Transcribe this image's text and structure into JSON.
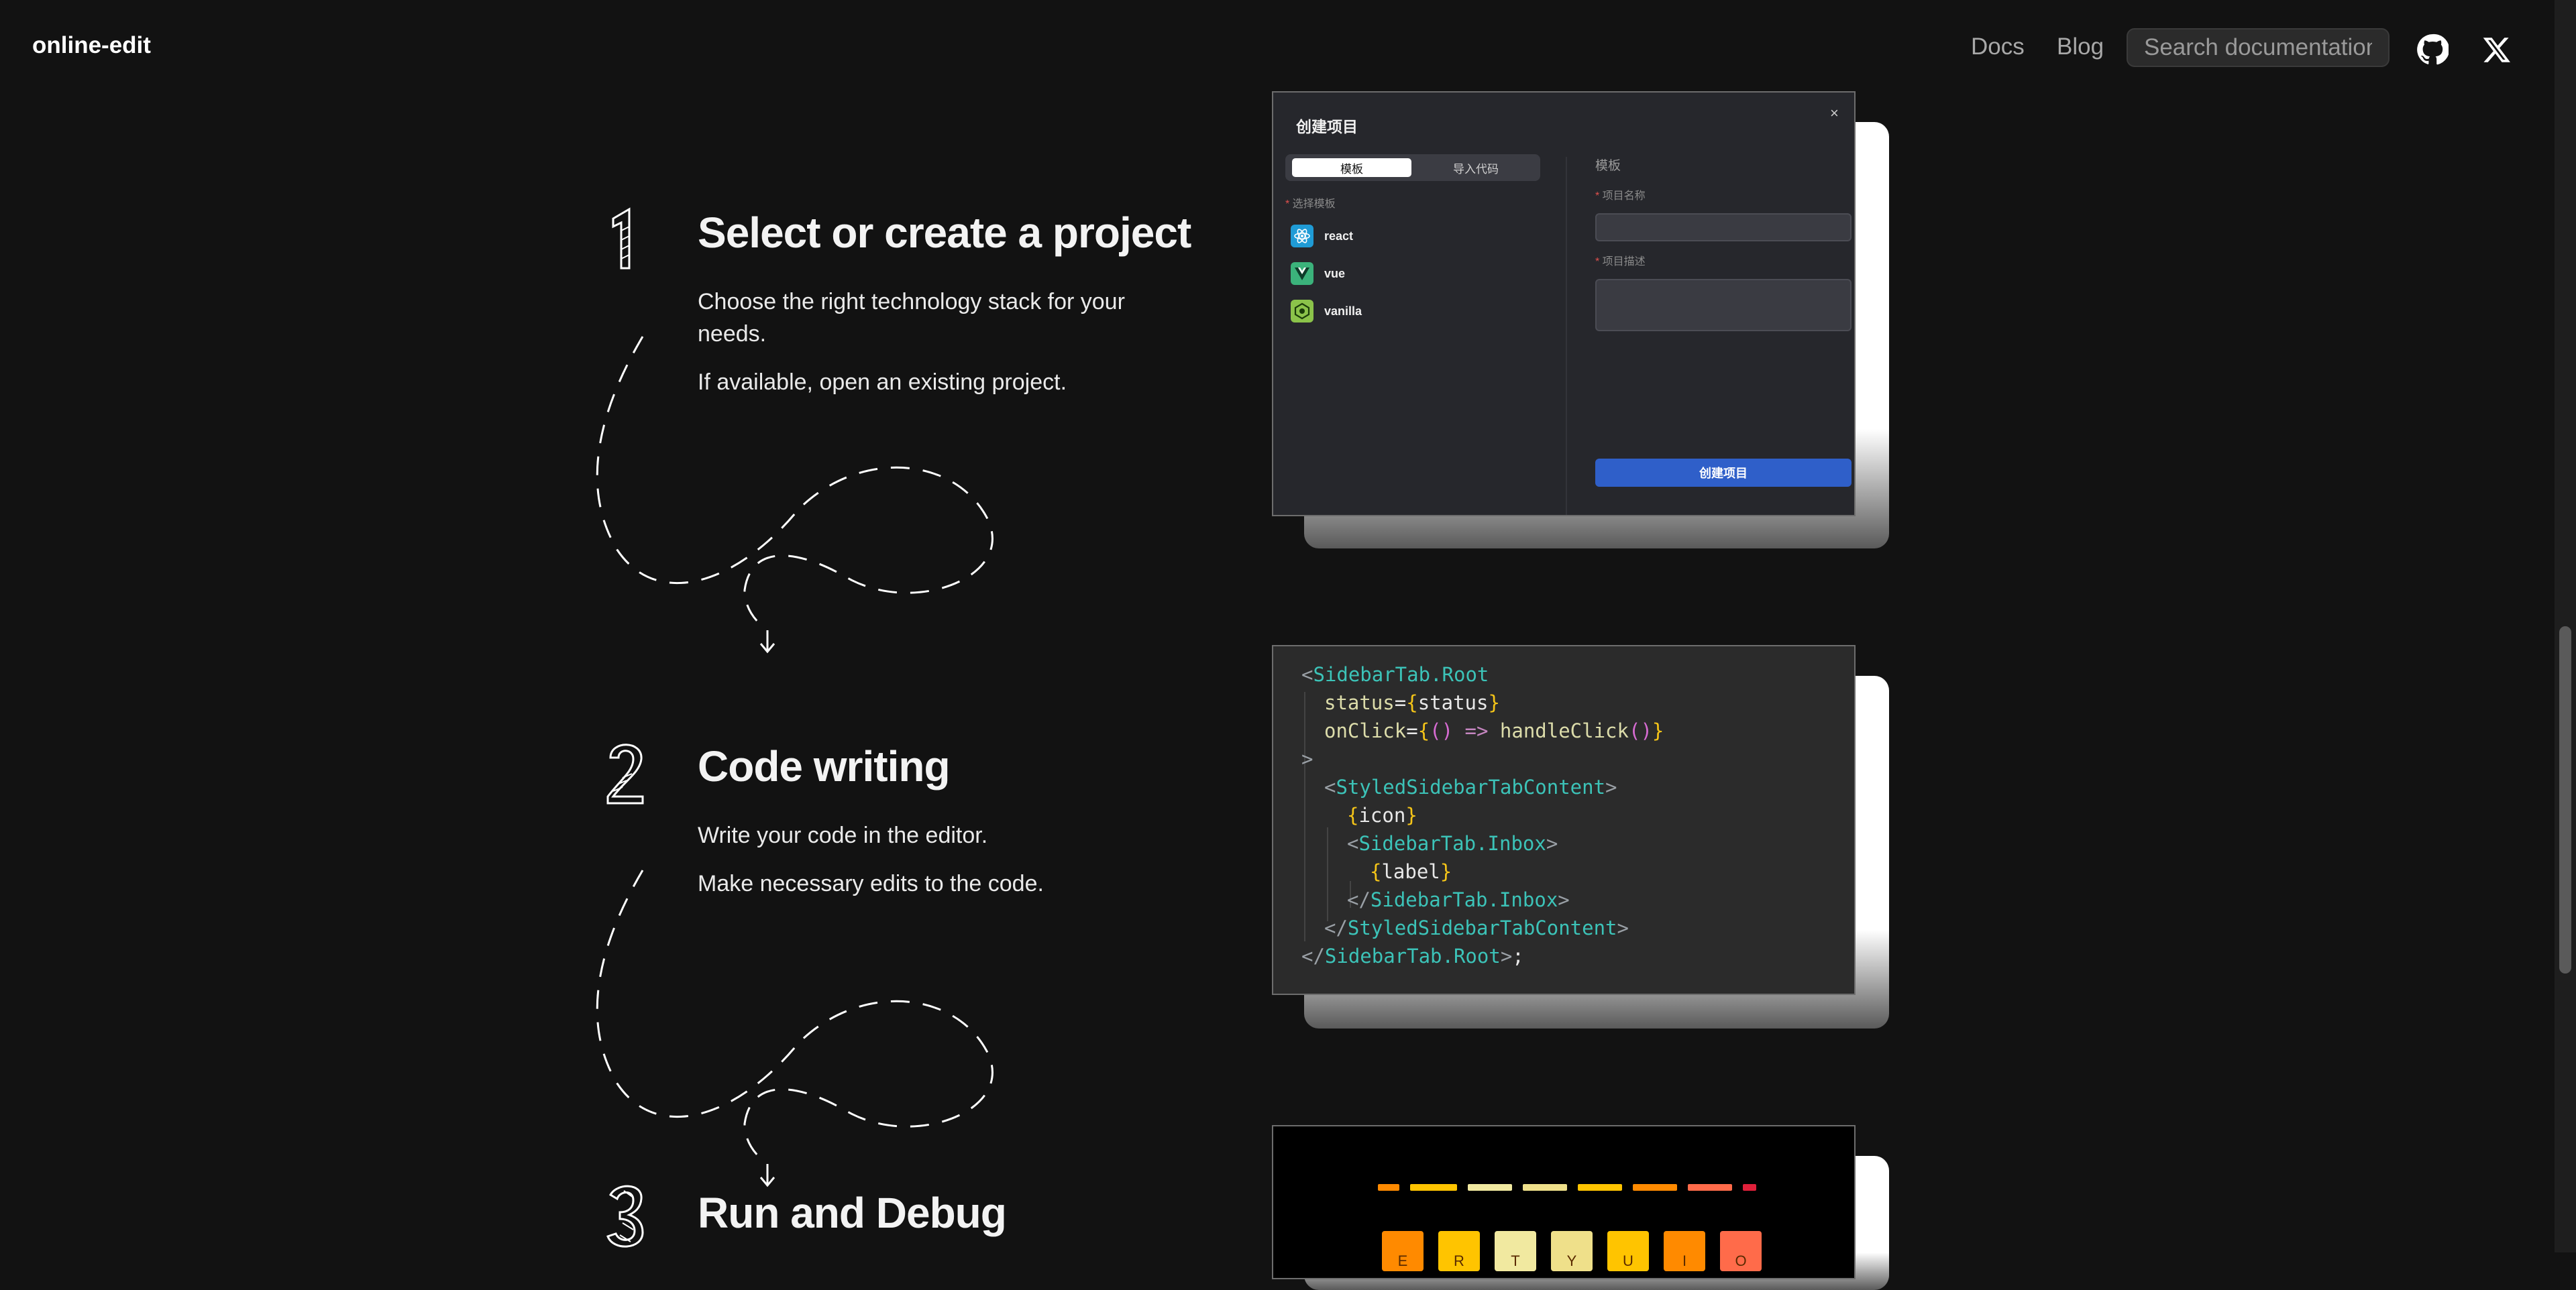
{
  "nav": {
    "brand": "online-edit",
    "links": [
      "Docs",
      "Blog"
    ],
    "search_placeholder": "Search documentation",
    "icons": [
      "github-icon",
      "x-icon"
    ]
  },
  "steps": [
    {
      "number": "1",
      "title": "Select or create a project",
      "paragraphs": [
        "Choose the right technology stack for your needs.",
        "If available, open an existing project."
      ]
    },
    {
      "number": "2",
      "title": "Code writing",
      "paragraphs": [
        "Write your code in the editor.",
        "Make necessary edits to the code."
      ]
    },
    {
      "number": "3",
      "title": "Run and Debug",
      "paragraphs": []
    }
  ],
  "dialog": {
    "title": "创建项目",
    "close": "×",
    "tabs": [
      "模板",
      "导入代码"
    ],
    "left_label": "选择模板",
    "templates": [
      {
        "name": "react",
        "icon": "react-icon",
        "color": "#1f9bd6"
      },
      {
        "name": "vue",
        "icon": "vue-icon",
        "color": "#3bb27b"
      },
      {
        "name": "vanilla",
        "icon": "vanilla-icon",
        "color": "#8bc34a"
      }
    ],
    "right_heading": "模板",
    "name_label": "项目名称",
    "desc_label": "项目描述",
    "submit": "创建项目"
  },
  "code": {
    "lines": [
      "<SidebarTab.Root",
      "status={status}",
      "onClick={() => handleClick()}",
      ">",
      "<StyledSidebarTabContent>",
      "{icon}",
      "<SidebarTab.Inbox>",
      "{label}",
      "</SidebarTab.Inbox>",
      "</StyledSidebarTabContent>",
      "</SidebarTab.Root>;"
    ]
  },
  "game": {
    "keys": [
      "E",
      "R",
      "T",
      "Y",
      "U",
      "I",
      "O"
    ],
    "key_colors": [
      "#ff8a00",
      "#ffc400",
      "#f1e9a0",
      "#efe08a",
      "#ffc400",
      "#ff8a00",
      "#ff6b4a"
    ]
  },
  "colors": {
    "background": "#121212",
    "accent_button": "#2f5fc9"
  }
}
